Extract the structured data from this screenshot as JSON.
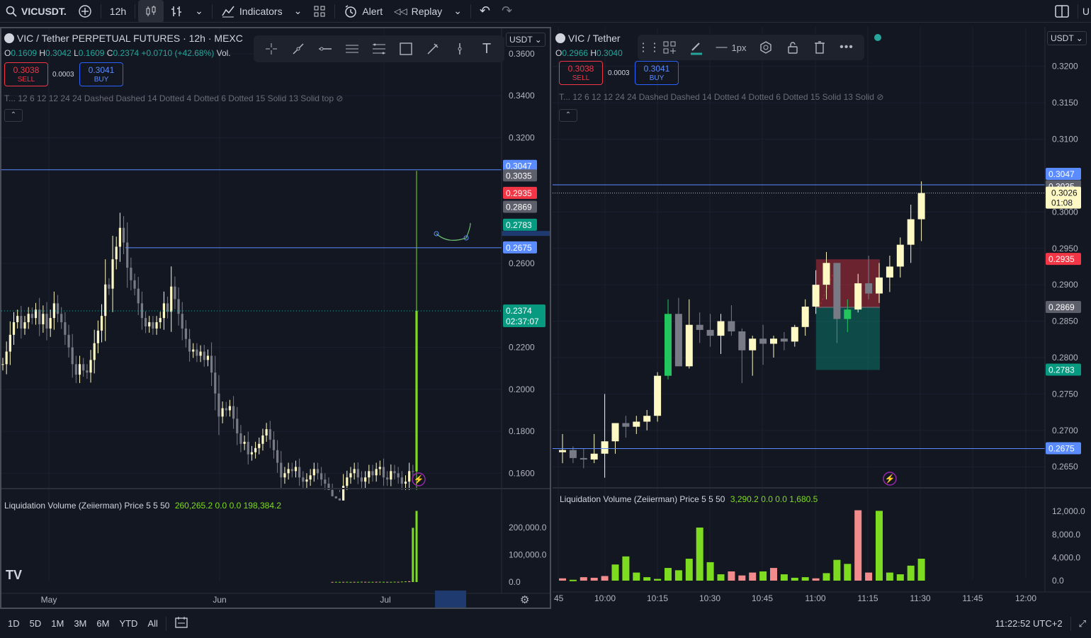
{
  "topbar": {
    "symbol": "VICUSDT.",
    "interval": "12h",
    "indicators": "Indicators",
    "alert": "Alert",
    "replay": "Replay",
    "user_initial": "U"
  },
  "colors": {
    "bg": "#131722",
    "up": "#fff9c4",
    "down": "#787b86",
    "green": "#26a69a",
    "red": "#f23645",
    "blue": "#2962ff"
  },
  "left": {
    "title": "VIC / Tether PERPETUAL FUTURES · 12h · MEXC",
    "ohlc": {
      "o": "0.1609",
      "h": "0.3042",
      "l": "0.1609",
      "c": "0.2374",
      "chg": "+0.0710 (+42.68%)",
      "vol": "Vol."
    },
    "sell_price": "0.3038",
    "sell_label": "SELL",
    "spread": "0.0003",
    "buy_price": "0.3041",
    "buy_label": "BUY",
    "indicator_line": "T... 12 6 12 12 24 24 Dashed Dashed 14 Dotted 4 Dotted 6 Dotted 15 Solid 13 Solid top",
    "unit": "USDT",
    "price_axis": [
      "0.3600",
      "0.3400",
      "0.3200",
      "0.2600",
      "0.2200",
      "0.2000",
      "0.1800",
      "0.1600"
    ],
    "tags": [
      {
        "v": "0.3047",
        "c": "#5b8cff"
      },
      {
        "v": "0.3035",
        "c": "#5d606b"
      },
      {
        "v": "0.2935",
        "c": "#f23645"
      },
      {
        "v": "0.2869",
        "c": "#5d606b"
      },
      {
        "v": "0.2783",
        "c": "#089981"
      },
      {
        "v": "0.2675",
        "c": "#5b8cff"
      }
    ],
    "last_price": "0.2374",
    "countdown": "02:37:07",
    "volume_legend": "Liquidation Volume (Zeiierman) Price 5 5 50",
    "volume_values": [
      "260,265.2",
      "0.0",
      "0.0",
      "198,384.2"
    ],
    "volume_axis": [
      "200,000.0",
      "100,000.0",
      "0.0"
    ],
    "time_axis": [
      "May",
      "Jun",
      "Jul"
    ],
    "chart_data": {
      "type": "candlestick",
      "close": [
        0.212,
        0.218,
        0.226,
        0.232,
        0.235,
        0.229,
        0.232,
        0.236,
        0.234,
        0.238,
        0.231,
        0.236,
        0.229,
        0.234,
        0.241,
        0.236,
        0.232,
        0.226,
        0.22,
        0.212,
        0.207,
        0.212,
        0.209,
        0.208,
        0.214,
        0.222,
        0.228,
        0.235,
        0.25,
        0.248,
        0.262,
        0.268,
        0.277,
        0.27,
        0.258,
        0.252,
        0.248,
        0.241,
        0.234,
        0.23,
        0.232,
        0.229,
        0.232,
        0.234,
        0.241,
        0.237,
        0.249,
        0.243,
        0.236,
        0.229,
        0.224,
        0.218,
        0.219,
        0.216,
        0.218,
        0.214,
        0.216,
        0.208,
        0.198,
        0.187,
        0.191,
        0.19,
        0.192,
        0.186,
        0.179,
        0.174,
        0.175,
        0.169,
        0.17,
        0.172,
        0.174,
        0.178,
        0.181,
        0.176,
        0.171,
        0.165,
        0.158,
        0.16,
        0.162,
        0.161,
        0.163,
        0.158,
        0.156,
        0.157,
        0.159,
        0.162,
        0.16,
        0.157,
        0.155,
        0.152,
        0.149,
        0.148,
        0.147,
        0.154,
        0.158,
        0.16,
        0.162,
        0.158,
        0.156,
        0.158,
        0.161,
        0.159,
        0.162,
        0.163,
        0.158,
        0.157,
        0.161,
        0.16,
        0.158,
        0.155,
        0.156,
        0.161,
        0.1609,
        0.2374
      ],
      "volume": [
        0,
        0,
        0,
        0,
        0,
        0,
        0,
        0,
        0,
        0,
        0,
        0,
        0,
        0,
        0,
        0,
        0,
        0,
        0,
        0,
        0,
        0,
        0,
        0,
        0,
        0,
        0,
        0,
        0,
        0,
        0,
        0,
        0,
        0,
        0,
        0,
        0,
        0,
        0,
        0,
        0,
        0,
        0,
        0,
        0,
        0,
        0,
        0,
        0,
        0,
        0,
        0,
        0,
        0,
        0,
        0,
        0,
        0,
        0,
        0,
        0,
        0,
        0,
        0,
        0,
        0,
        0,
        0,
        0,
        0,
        0,
        0,
        0,
        0,
        0,
        0,
        0,
        0,
        0,
        0,
        0,
        0,
        0,
        0,
        0,
        0,
        0,
        0,
        0,
        0,
        500,
        800,
        600,
        700,
        900,
        500,
        800,
        700,
        1200,
        900,
        700,
        800,
        900,
        1100,
        900,
        700,
        800,
        1200,
        900,
        1800,
        2500,
        3000,
        198384.2,
        260265.2
      ],
      "ylim": [
        0.152,
        0.362
      ],
      "vol_ylim": [
        0,
        290000
      ]
    }
  },
  "right": {
    "title": "VIC / Tether",
    "ohlc": {
      "o": "0.2966",
      "h": "0.3040"
    },
    "sell_price": "0.3038",
    "sell_label": "SELL",
    "spread": "0.0003",
    "buy_price": "0.3041",
    "buy_label": "BUY",
    "indicator_line": "T... 12 6 12 12 24 24 Dashed Dashed 14 Dotted 4 Dotted 6 Dotted 15 Solid 13 Solid",
    "unit": "USDT",
    "stroke": "1px",
    "price_axis": [
      "0.3200",
      "0.3150",
      "0.3100",
      "0.3000",
      "0.2950",
      "0.2900",
      "0.2850",
      "0.2800",
      "0.2750",
      "0.2700",
      "0.2650"
    ],
    "tags": [
      {
        "v": "0.3047",
        "c": "#5b8cff"
      },
      {
        "v": "0.3035",
        "c": "#5d606b"
      },
      {
        "v": "0.2935",
        "c": "#f23645"
      },
      {
        "v": "0.2869",
        "c": "#5d606b"
      },
      {
        "v": "0.2783",
        "c": "#089981"
      },
      {
        "v": "0.2675",
        "c": "#5b8cff"
      }
    ],
    "last_price": "0.3026",
    "countdown": "01:08",
    "volume_legend": "Liquidation Volume (Zeiierman) Price 5 5 50",
    "volume_values": [
      "3,290.2",
      "0.0",
      "0.0",
      "1,680.5"
    ],
    "volume_axis": [
      "12,000.0",
      "8,000.0",
      "4,000.0",
      "0.0"
    ],
    "time_axis": [
      "45",
      "10:00",
      "10:15",
      "10:30",
      "10:45",
      "11:00",
      "11:15",
      "11:30",
      "11:45",
      "12:00"
    ],
    "chart_data": {
      "type": "candlestick",
      "candles": [
        {
          "o": 0.267,
          "h": 0.2695,
          "l": 0.2655,
          "c": 0.2673
        },
        {
          "o": 0.2673,
          "h": 0.2678,
          "l": 0.2655,
          "c": 0.2662
        },
        {
          "o": 0.2662,
          "h": 0.2675,
          "l": 0.2648,
          "c": 0.266
        },
        {
          "o": 0.266,
          "h": 0.2695,
          "l": 0.2655,
          "c": 0.2668
        },
        {
          "o": 0.2668,
          "h": 0.275,
          "l": 0.2635,
          "c": 0.2685
        },
        {
          "o": 0.2685,
          "h": 0.271,
          "l": 0.2668,
          "c": 0.271
        },
        {
          "o": 0.271,
          "h": 0.272,
          "l": 0.269,
          "c": 0.2705
        },
        {
          "o": 0.2705,
          "h": 0.272,
          "l": 0.2695,
          "c": 0.2712
        },
        {
          "o": 0.2712,
          "h": 0.2728,
          "l": 0.27,
          "c": 0.272
        },
        {
          "o": 0.272,
          "h": 0.278,
          "l": 0.2712,
          "c": 0.2775
        },
        {
          "o": 0.2775,
          "h": 0.288,
          "l": 0.277,
          "c": 0.286
        },
        {
          "o": 0.286,
          "h": 0.2882,
          "l": 0.279,
          "c": 0.2788
        },
        {
          "o": 0.2788,
          "h": 0.288,
          "l": 0.2785,
          "c": 0.2845
        },
        {
          "o": 0.2845,
          "h": 0.2862,
          "l": 0.282,
          "c": 0.2838
        },
        {
          "o": 0.2838,
          "h": 0.286,
          "l": 0.2815,
          "c": 0.283
        },
        {
          "o": 0.283,
          "h": 0.286,
          "l": 0.2805,
          "c": 0.285
        },
        {
          "o": 0.285,
          "h": 0.2872,
          "l": 0.283,
          "c": 0.2836
        },
        {
          "o": 0.2836,
          "h": 0.284,
          "l": 0.2765,
          "c": 0.281
        },
        {
          "o": 0.281,
          "h": 0.283,
          "l": 0.2775,
          "c": 0.2826
        },
        {
          "o": 0.2826,
          "h": 0.2845,
          "l": 0.279,
          "c": 0.2819
        },
        {
          "o": 0.2819,
          "h": 0.283,
          "l": 0.28,
          "c": 0.2826
        },
        {
          "o": 0.2826,
          "h": 0.2835,
          "l": 0.281,
          "c": 0.2822
        },
        {
          "o": 0.2822,
          "h": 0.2845,
          "l": 0.2815,
          "c": 0.2842
        },
        {
          "o": 0.2842,
          "h": 0.288,
          "l": 0.283,
          "c": 0.287
        },
        {
          "o": 0.287,
          "h": 0.292,
          "l": 0.286,
          "c": 0.29
        },
        {
          "o": 0.29,
          "h": 0.2945,
          "l": 0.288,
          "c": 0.293
        },
        {
          "o": 0.293,
          "h": 0.291,
          "l": 0.282,
          "c": 0.2853
        },
        {
          "o": 0.2853,
          "h": 0.288,
          "l": 0.2835,
          "c": 0.2866
        },
        {
          "o": 0.2866,
          "h": 0.2915,
          "l": 0.2862,
          "c": 0.2902
        },
        {
          "o": 0.2902,
          "h": 0.294,
          "l": 0.288,
          "c": 0.2888
        },
        {
          "o": 0.2888,
          "h": 0.293,
          "l": 0.2875,
          "c": 0.291
        },
        {
          "o": 0.291,
          "h": 0.294,
          "l": 0.289,
          "c": 0.2925
        },
        {
          "o": 0.2925,
          "h": 0.2965,
          "l": 0.291,
          "c": 0.2955
        },
        {
          "o": 0.2955,
          "h": 0.301,
          "l": 0.293,
          "c": 0.299
        },
        {
          "o": 0.299,
          "h": 0.3042,
          "l": 0.296,
          "c": 0.3026
        }
      ],
      "volume": [
        400,
        150,
        600,
        500,
        800,
        2800,
        4200,
        1400,
        600,
        300,
        2200,
        1800,
        3800,
        9200,
        3200,
        1100,
        1600,
        900,
        1400,
        1600,
        2200,
        1100,
        500,
        600,
        400,
        1300,
        3600,
        2900,
        12200,
        1400,
        12100,
        1400,
        1100,
        2600,
        3800
      ],
      "volume_up": [
        false,
        true,
        false,
        false,
        false,
        true,
        true,
        true,
        true,
        true,
        true,
        true,
        true,
        true,
        true,
        true,
        false,
        false,
        false,
        true,
        false,
        true,
        true,
        true,
        false,
        true,
        true,
        true,
        false,
        false,
        true,
        true,
        true,
        true,
        true
      ],
      "ylim": [
        0.2622,
        0.3225
      ],
      "vol_ylim": [
        0,
        13500
      ]
    }
  },
  "bottombar": {
    "ranges": [
      "1D",
      "5D",
      "1M",
      "3M",
      "6M",
      "YTD",
      "All"
    ],
    "clock": "11:22:52 UTC+2"
  }
}
